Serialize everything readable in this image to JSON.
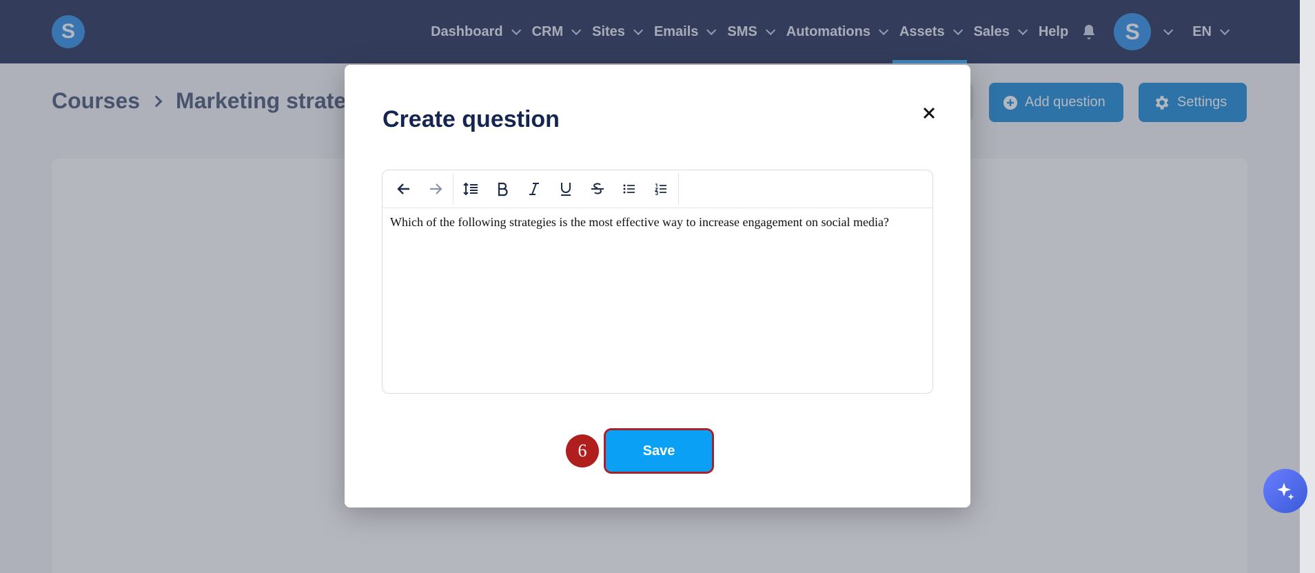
{
  "nav": {
    "logo_letter": "S",
    "items": [
      {
        "label": "Dashboard",
        "has_dropdown": true
      },
      {
        "label": "CRM",
        "has_dropdown": true
      },
      {
        "label": "Sites",
        "has_dropdown": true
      },
      {
        "label": "Emails",
        "has_dropdown": true
      },
      {
        "label": "SMS",
        "has_dropdown": true
      },
      {
        "label": "Automations",
        "has_dropdown": true
      },
      {
        "label": "Assets",
        "has_dropdown": true,
        "active": true
      },
      {
        "label": "Sales",
        "has_dropdown": true
      },
      {
        "label": "Help",
        "has_dropdown": false
      }
    ],
    "bell_icon": "bell-icon",
    "avatar_letter": "S",
    "language": "EN"
  },
  "breadcrumb": {
    "root": "Courses",
    "current": "Marketing strateg"
  },
  "actions": {
    "add_question": "Add question",
    "settings": "Settings"
  },
  "modal": {
    "title": "Create question",
    "close_icon": "close-icon",
    "editor": {
      "content": "Which of the following strategies is the most effective way to increase engagement on social media?"
    },
    "save_label": "Save",
    "step_number": "6"
  },
  "colors": {
    "nav_bg": "#13224b",
    "primary": "#0a84d8",
    "save": "#0aa0f5",
    "highlight": "#a8202a"
  }
}
